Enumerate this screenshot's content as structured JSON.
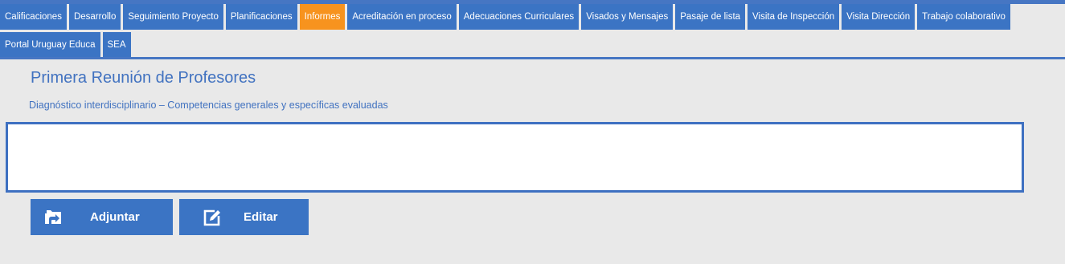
{
  "nav": {
    "tabs": [
      {
        "label": "Calificaciones",
        "active": false
      },
      {
        "label": "Desarrollo",
        "active": false
      },
      {
        "label": "Seguimiento Proyecto",
        "active": false
      },
      {
        "label": "Planificaciones",
        "active": false
      },
      {
        "label": "Informes",
        "active": true
      },
      {
        "label": "Acreditación en proceso",
        "active": false
      },
      {
        "label": "Adecuaciones Curriculares",
        "active": false
      },
      {
        "label": "Visados y Mensajes",
        "active": false
      },
      {
        "label": "Pasaje de lista",
        "active": false
      },
      {
        "label": "Visita de Inspección",
        "active": false
      },
      {
        "label": "Visita Dirección",
        "active": false
      },
      {
        "label": "Trabajo colaborativo",
        "active": false
      },
      {
        "label": "Portal Uruguay Educa",
        "active": false
      },
      {
        "label": "SEA",
        "active": false
      }
    ]
  },
  "report": {
    "title": "Primera Reunión de Profesores",
    "subtitle": "Diagnóstico interdisciplinario – Competencias generales y específicas evaluadas",
    "content": ""
  },
  "actions": {
    "attach_label": "Adjuntar",
    "attach_icon": "folder-icon",
    "edit_label": "Editar",
    "edit_icon": "edit-icon"
  },
  "colors": {
    "primary": "#3b74c4",
    "active_tab": "#f7931e",
    "background": "#e9e9e9",
    "heading": "#4172c0"
  }
}
